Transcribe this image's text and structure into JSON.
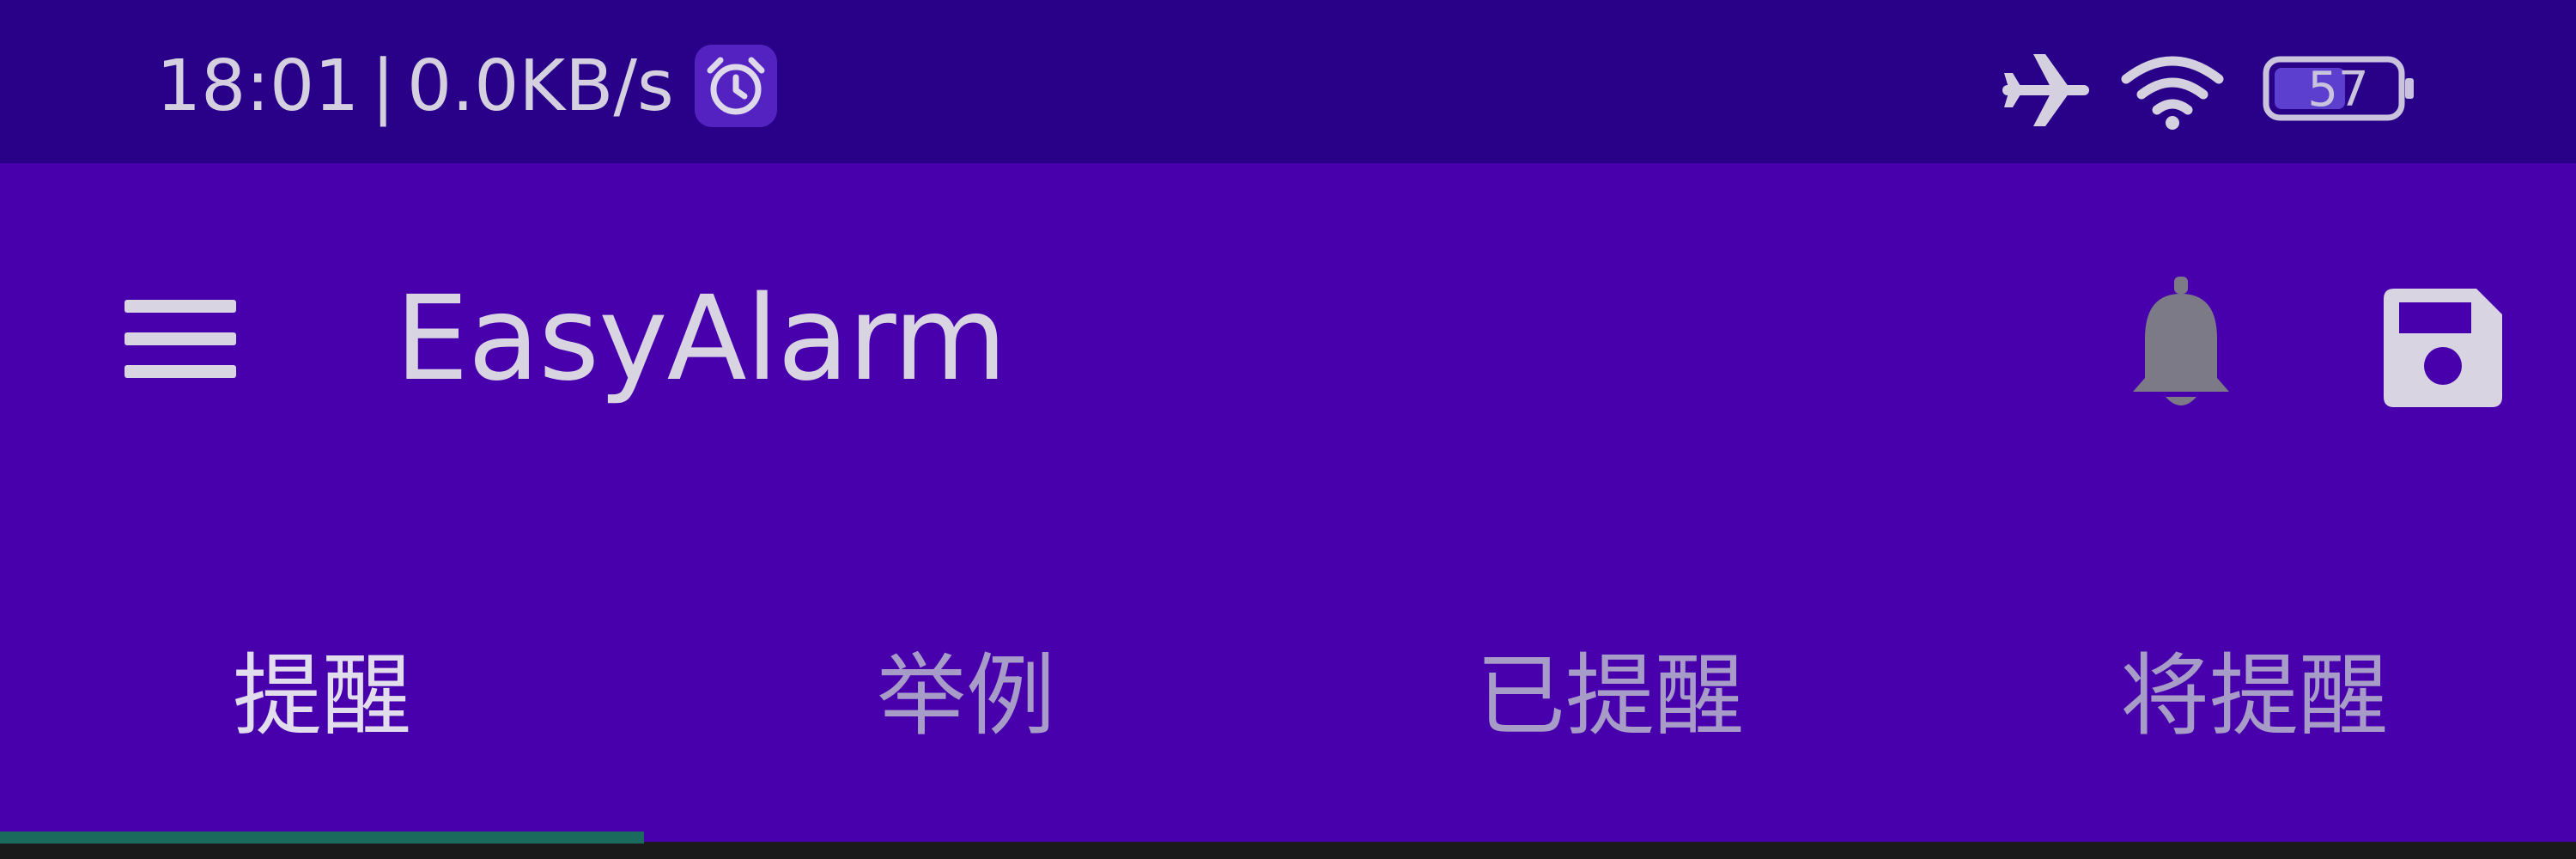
{
  "status_bar": {
    "time": "18:01",
    "separator": "|",
    "net_speed": "0.0KB/s",
    "icons": [
      "alarm-clock-icon",
      "airplane-icon",
      "wifi-icon",
      "battery-icon"
    ],
    "battery_level": "57"
  },
  "app_bar": {
    "title": "EasyAlarm",
    "icons": [
      "menu-icon",
      "bell-icon",
      "save-icon"
    ]
  },
  "tabs": [
    {
      "label": "提醒",
      "active": true
    },
    {
      "label": "举例",
      "active": false
    },
    {
      "label": "已提醒",
      "active": false
    },
    {
      "label": "将提醒",
      "active": false
    }
  ],
  "colors": {
    "status_bar_bg": "#290088",
    "app_bar_bg": "#4800ac",
    "indicator": "#1b6a5e",
    "text_active": "#e2ddec",
    "text_inactive": "#a79bc8",
    "icon_gray": "#7c7a87"
  }
}
